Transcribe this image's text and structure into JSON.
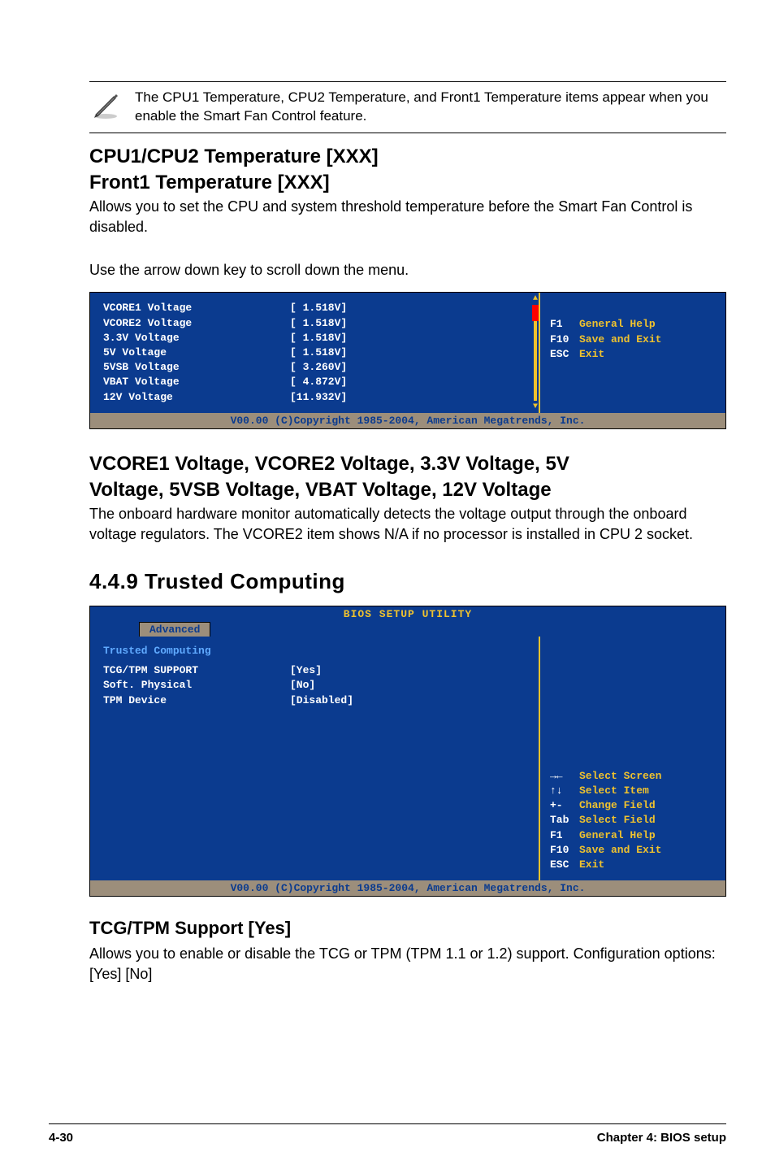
{
  "note": {
    "text": "The CPU1 Temperature, CPU2 Temperature, and Front1 Temperature items appear when you enable the Smart Fan Control feature."
  },
  "sec1": {
    "title_l1": "CPU1/CPU2 Temperature [XXX]",
    "title_l2": "Front1 Temperature [XXX]",
    "body": "Allows you to set the CPU and system threshold temperature before the Smart Fan Control is disabled."
  },
  "scroll_hint": "Use the arrow down key to scroll down the menu.",
  "bios1": {
    "rows": [
      {
        "label": "VCORE1 Voltage",
        "value": "[ 1.518V]"
      },
      {
        "label": "VCORE2 Voltage",
        "value": "[ 1.518V]"
      },
      {
        "label": "3.3V Voltage",
        "value": "[ 1.518V]"
      },
      {
        "label": "5V Voltage",
        "value": "[ 1.518V]"
      },
      {
        "label": "5VSB Voltage",
        "value": "[ 3.260V]"
      },
      {
        "label": "VBAT Voltage",
        "value": "[ 4.872V]"
      },
      {
        "label": "12V Voltage",
        "value": "[11.932V]"
      }
    ],
    "hints": [
      {
        "key": "F1",
        "txt": "General Help"
      },
      {
        "key": "F10",
        "txt": "Save and Exit"
      },
      {
        "key": "ESC",
        "txt": "Exit"
      }
    ],
    "footer": "V00.00 (C)Copyright 1985-2004, American Megatrends, Inc."
  },
  "sec2": {
    "title_l1": "VCORE1 Voltage, VCORE2 Voltage, 3.3V Voltage, 5V",
    "title_l2": "Voltage, 5VSB Voltage, VBAT Voltage, 12V Voltage",
    "body": "The onboard hardware monitor automatically detects the voltage output through the onboard voltage regulators. The VCORE2 item shows N/A if no processor is installed in CPU 2 socket."
  },
  "tc_heading": "4.4.9    Trusted Computing",
  "bios2": {
    "title": "BIOS SETUP UTILITY",
    "tab": "Advanced",
    "header": "Trusted Computing",
    "rows": [
      {
        "label": "TCG/TPM SUPPORT",
        "value": "[Yes]"
      },
      {
        "label": "Soft. Physical",
        "value": "[No]"
      },
      {
        "label": "TPM Device",
        "value": "[Disabled]"
      }
    ],
    "hints": [
      {
        "key": "→←",
        "txt": "Select Screen"
      },
      {
        "key": "↑↓",
        "txt": "Select Item"
      },
      {
        "key": "+-",
        "txt": "Change Field"
      },
      {
        "key": "Tab",
        "txt": "Select Field"
      },
      {
        "key": "F1",
        "txt": "General Help"
      },
      {
        "key": "F10",
        "txt": "Save and Exit"
      },
      {
        "key": "ESC",
        "txt": "Exit"
      }
    ],
    "footer": "V00.00 (C)Copyright 1985-2004, American Megatrends, Inc."
  },
  "sec3": {
    "title": "TCG/TPM Support [Yes]",
    "body": "Allows you to enable or disable the TCG or TPM (TPM 1.1 or 1.2) support. Configuration options: [Yes] [No]"
  },
  "footer": {
    "left": "4-30",
    "right": "Chapter 4: BIOS setup"
  }
}
